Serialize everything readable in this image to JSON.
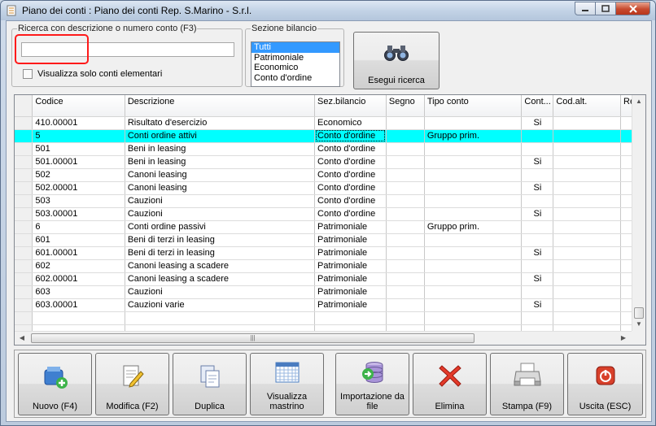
{
  "window": {
    "title": "Piano dei conti : Piano dei conti Rep. S.Marino - S.r.l.",
    "controls": {
      "minimize": "minimize",
      "maximize": "maximize",
      "close": "close"
    }
  },
  "search": {
    "legend": "Ricerca con descrizione o numero conto (F3)",
    "value": "",
    "placeholder": "",
    "only_elementary_label": "Visualizza solo conti elementari",
    "only_elementary_checked": false
  },
  "section": {
    "legend": "Sezione bilancio",
    "options": [
      "Tutti",
      "Patrimoniale",
      "Economico",
      "Conto d'ordine"
    ],
    "selected": "Tutti"
  },
  "search_button": {
    "label": "Esegui ricerca",
    "icon": "binoculars-icon"
  },
  "grid": {
    "columns": [
      "Codice",
      "Descrizione",
      "Sez.bilancio",
      "Segno",
      "Tipo conto",
      "Cont...",
      "Cod.alt.",
      "Re"
    ],
    "rows": [
      [
        "410.00001",
        "Risultato d'esercizio",
        "Economico",
        "",
        "",
        "Si",
        ""
      ],
      [
        "5",
        "Conti ordine attivi",
        "Conto d'ordine",
        "",
        "Gruppo prim.",
        "",
        ""
      ],
      [
        "501",
        "Beni in leasing",
        "Conto d'ordine",
        "",
        "",
        "",
        ""
      ],
      [
        "501.00001",
        "Beni in leasing",
        "Conto d'ordine",
        "",
        "",
        "Si",
        ""
      ],
      [
        "502",
        "Canoni leasing",
        "Conto d'ordine",
        "",
        "",
        "",
        ""
      ],
      [
        "502.00001",
        "Canoni leasing",
        "Conto d'ordine",
        "",
        "",
        "Si",
        ""
      ],
      [
        "503",
        "Cauzioni",
        "Conto d'ordine",
        "",
        "",
        "",
        ""
      ],
      [
        "503.00001",
        "Cauzioni",
        "Conto d'ordine",
        "",
        "",
        "Si",
        ""
      ],
      [
        "6",
        "Conti ordine passivi",
        "Patrimoniale",
        "",
        "Gruppo prim.",
        "",
        ""
      ],
      [
        "601",
        "Beni di terzi in leasing",
        "Patrimoniale",
        "",
        "",
        "",
        ""
      ],
      [
        "601.00001",
        "Beni di terzi in leasing",
        "Patrimoniale",
        "",
        "",
        "Si",
        ""
      ],
      [
        "602",
        "Canoni leasing a scadere",
        "Patrimoniale",
        "",
        "",
        "",
        ""
      ],
      [
        "602.00001",
        "Canoni leasing a scadere",
        "Patrimoniale",
        "",
        "",
        "Si",
        ""
      ],
      [
        "603",
        "Cauzioni",
        "Patrimoniale",
        "",
        "",
        "",
        ""
      ],
      [
        "603.00001",
        "Cauzioni varie",
        "Patrimoniale",
        "",
        "",
        "Si",
        ""
      ],
      [
        "",
        "",
        "",
        "",
        "",
        "",
        ""
      ],
      [
        "",
        "",
        "",
        "",
        "",
        "",
        ""
      ]
    ],
    "selected_row": 1,
    "highlight_color": "#00ffff"
  },
  "toolbar": {
    "buttons": [
      {
        "id": "nuovo",
        "label": "Nuovo (F4)",
        "icon": "new-record-icon"
      },
      {
        "id": "modifica",
        "label": "Modifica (F2)",
        "icon": "edit-icon"
      },
      {
        "id": "duplica",
        "label": "Duplica",
        "icon": "duplicate-icon"
      },
      {
        "id": "visualizza",
        "label": "Visualizza mastrino",
        "icon": "calendar-icon"
      },
      {
        "id": "importazione",
        "label": "Importazione da file",
        "icon": "database-import-icon"
      },
      {
        "id": "elimina",
        "label": "Elimina",
        "icon": "delete-x-icon"
      },
      {
        "id": "stampa",
        "label": "Stampa (F9)",
        "icon": "printer-icon"
      },
      {
        "id": "uscita",
        "label": "Uscita (ESC)",
        "icon": "exit-icon"
      }
    ]
  },
  "colors": {
    "accent_selection": "#3399ff",
    "row_highlight": "#00ffff",
    "close_button": "#c74a2e",
    "annotation_box": "#ff1a1a"
  }
}
